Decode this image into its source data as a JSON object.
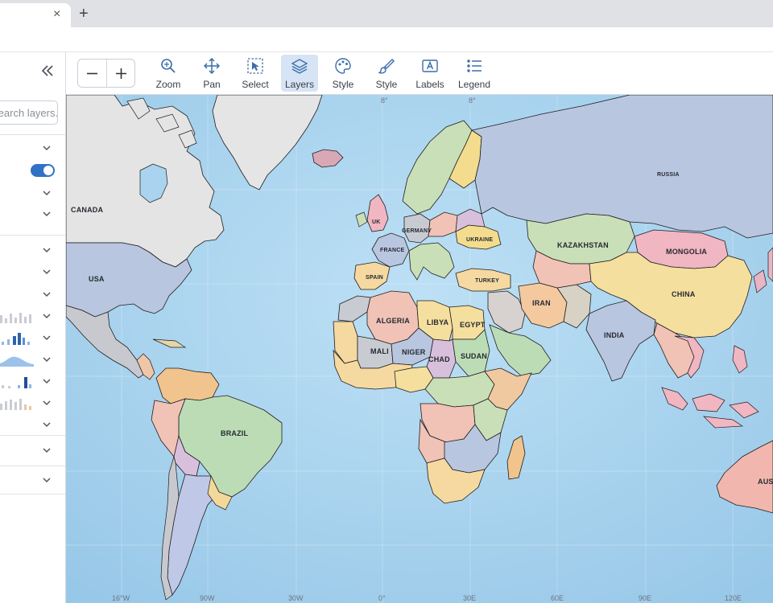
{
  "browser": {
    "close_glyph": "×",
    "new_tab_glyph": "+"
  },
  "sidebar": {
    "collapse_icon": "double-chevron-left-icon",
    "search_placeholder": "Search layers..."
  },
  "toolbar": {
    "zoom_out": "−",
    "zoom_in": "+",
    "tools": [
      {
        "label": "Zoom",
        "icon": "zoom-icon",
        "active": false
      },
      {
        "label": "Pan",
        "icon": "pan-icon",
        "active": false
      },
      {
        "label": "Select",
        "icon": "select-icon",
        "active": false
      },
      {
        "label": "Layers",
        "icon": "layers-icon",
        "active": true
      },
      {
        "label": "Style",
        "icon": "palette-icon",
        "active": false
      },
      {
        "label": "Style",
        "icon": "brush-icon",
        "active": false
      },
      {
        "label": "Labels",
        "icon": "labels-icon",
        "active": false
      },
      {
        "label": "Legend",
        "icon": "legend-icon",
        "active": false
      }
    ]
  },
  "map": {
    "countries": {
      "canada": "CANADA",
      "usa": "USA",
      "brazil": "BRAZIL",
      "uk": "UK",
      "germany": "GERMANY",
      "france": "FRANCE",
      "spain": "SPAIN",
      "ukraine": "UKRAINE",
      "turkey": "TURKEY",
      "russia": "RUSSIA",
      "kazakhstan": "KAZAKHSTAN",
      "mongolia": "MONGOLIA",
      "china": "CHINA",
      "iran": "IRAN",
      "india": "INDIA",
      "algeria": "ALGERIA",
      "libya": "LIBYA",
      "egypt": "EGYPT",
      "mali": "MALI",
      "niger": "NIGER",
      "chad": "CHAD",
      "sudan": "SUDAN",
      "australia": "AUSTRALIA"
    },
    "graticule_top": [
      "8°",
      "8°"
    ],
    "graticule_bottom": [
      "16°W",
      "90W",
      "30W",
      "0°",
      "30E",
      "60E",
      "90E",
      "120E"
    ],
    "colors": {
      "ocean": "#a9d3ee",
      "land_grey": "#e4e4e4",
      "accent": "#2f72c6"
    }
  }
}
